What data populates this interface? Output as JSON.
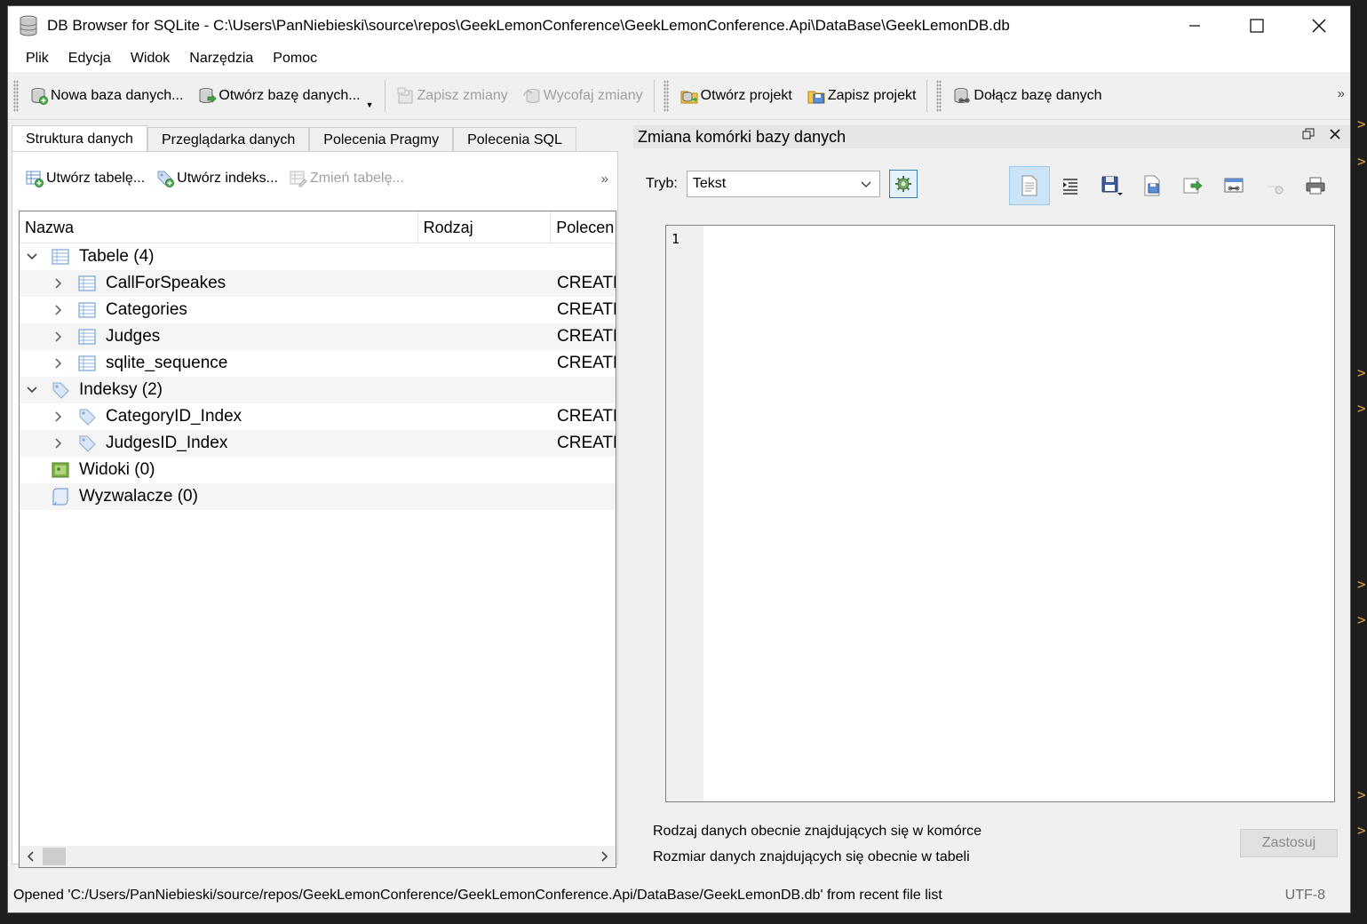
{
  "window": {
    "title": "DB Browser for SQLite - C:\\Users\\PanNiebieski\\source\\repos\\GeekLemonConference\\GeekLemonConference.Api\\DataBase\\GeekLemonDB.db"
  },
  "menu": [
    "Plik",
    "Edycja",
    "Widok",
    "Narzędzia",
    "Pomoc"
  ],
  "toolbar": {
    "new_db": "Nowa baza danych...",
    "open_db": "Otwórz bazę danych...",
    "save_changes": "Zapisz zmiany",
    "revert_changes": "Wycofaj zmiany",
    "open_project": "Otwórz projekt",
    "save_project": "Zapisz projekt",
    "attach_db": "Dołącz bazę danych",
    "more": "»"
  },
  "tabs": [
    "Struktura danych",
    "Przeglądarka danych",
    "Polecenia Pragmy",
    "Polecenia SQL"
  ],
  "structure_toolbar": {
    "create_table": "Utwórz tabelę...",
    "create_index": "Utwórz indeks...",
    "modify_table": "Zmień tabelę...",
    "more": "»"
  },
  "tree": {
    "columns": [
      "Nazwa",
      "Rodzaj",
      "Polecen"
    ],
    "groups": {
      "tables": "Tabele (4)",
      "indexes": "Indeksy (2)",
      "views": "Widoki (0)",
      "triggers": "Wyzwalacze (0)"
    },
    "tables": [
      {
        "name": "CallForSpeakes",
        "cmd": "CREATE"
      },
      {
        "name": "Categories",
        "cmd": "CREATE"
      },
      {
        "name": "Judges",
        "cmd": "CREATE"
      },
      {
        "name": "sqlite_sequence",
        "cmd": "CREATE"
      }
    ],
    "indexes": [
      {
        "name": "CategoryID_Index",
        "cmd": "CREATE"
      },
      {
        "name": "JudgesID_Index",
        "cmd": "CREATE"
      }
    ]
  },
  "edit_cell": {
    "title": "Zmiana komórki bazy danych",
    "mode_label": "Tryb:",
    "mode_value": "Tekst",
    "line_number": "1",
    "info_type": "Rodzaj danych obecnie znajdujących się w komórce",
    "info_size": "Rozmiar danych znajdujących się obecnie w tabeli",
    "apply": "Zastosuj"
  },
  "status": {
    "message": "Opened 'C:/Users/PanNiebieski/source/repos/GeekLemonConference/GeekLemonConference.Api/DataBase/GeekLemonDB.db' from recent file list",
    "encoding": "UTF-8"
  }
}
